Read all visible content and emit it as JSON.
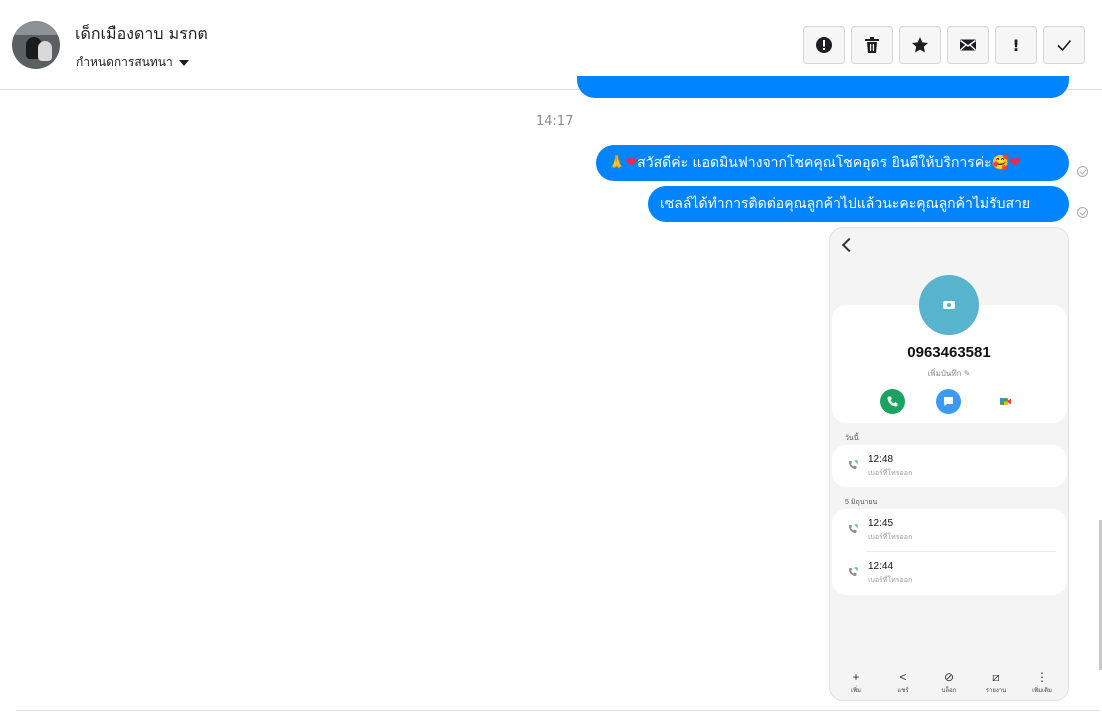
{
  "header": {
    "contact_name": "เด็กเมืองดาบ มรกต",
    "contact_subtitle": "กำหนดการสนทนา",
    "toolbar": [
      {
        "name": "alert-icon"
      },
      {
        "name": "trash-icon"
      },
      {
        "name": "star-icon"
      },
      {
        "name": "envelope-icon"
      },
      {
        "name": "exclamation-icon",
        "glyph": "!"
      },
      {
        "name": "check-icon"
      }
    ]
  },
  "chat": {
    "timestamp": "14:17",
    "messages": [
      {
        "prefix": "🙏",
        "heart1": "❤",
        "text": " สวัสดีค่ะ แอดมินฟางจากโชคคุณโชคอุดร ยินดีให้บริการค่ะ🥰",
        "heart2": "❤"
      },
      {
        "text": "เซลล์ได้ทำการติดต่อคุณลูกค้าไปแล้วนะคะคุณลูกค้าไม่รับสาย"
      }
    ]
  },
  "phone": {
    "number": "0963463581",
    "note": "เพิ่มบันทึก ✎",
    "sections": [
      "วันนี้",
      "5 มิถุนายน"
    ],
    "calls": [
      {
        "time": "12:48",
        "label": "เบอร์ที่โทรออก"
      },
      {
        "time": "12:45",
        "label": "เบอร์ที่โทรออก"
      },
      {
        "time": "12:44",
        "label": "เบอร์ที่โทรออก"
      }
    ],
    "nav": [
      {
        "glyph": "+",
        "label": "เพิ่ม"
      },
      {
        "glyph": "<",
        "label": "แชร์"
      },
      {
        "glyph": "⊘",
        "label": "บล็อก"
      },
      {
        "glyph": "⧄",
        "label": "รายงาน"
      },
      {
        "glyph": "⋮",
        "label": "เพิ่มเติม"
      }
    ]
  },
  "colors": {
    "bubble": "#0084ff",
    "call_green": "#1aa260",
    "message_blue": "#3c9bf0",
    "avatar_teal": "#58b3cc"
  }
}
